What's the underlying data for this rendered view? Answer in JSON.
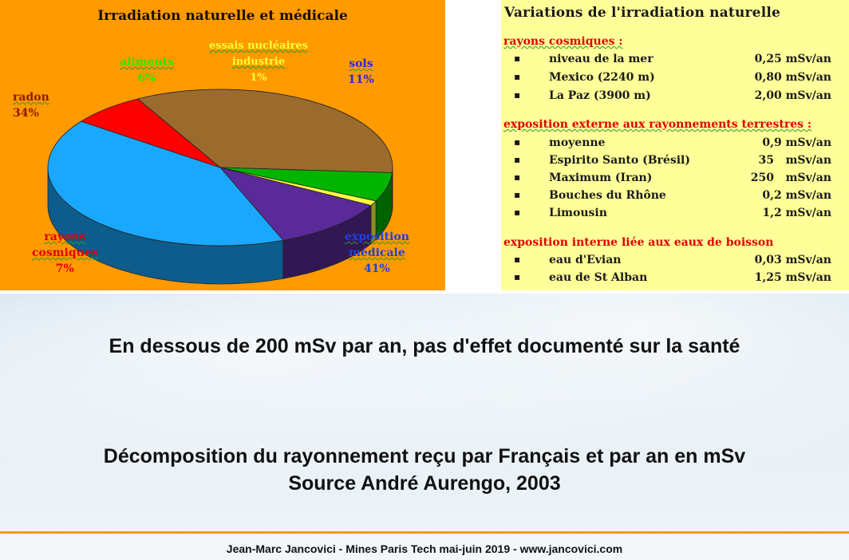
{
  "chart_data": {
    "type": "pie",
    "title": "Irradiation naturelle et médicale",
    "slices": [
      {
        "name": "radon",
        "percent_label": "34%",
        "value": 34,
        "color": "#9b6b2e",
        "label_color": "#8b1a00"
      },
      {
        "name": "aliments",
        "percent_label": "6%",
        "value": 6,
        "color": "#00b400",
        "label_color": "#2ee600"
      },
      {
        "name": "essais nucléaires industrie",
        "percent_label": "1%",
        "value": 1,
        "color": "#ffff40",
        "label_color": "#ffff33"
      },
      {
        "name": "sols",
        "percent_label": "11%",
        "value": 11,
        "color": "#5a2a9a",
        "label_color": "#2a2ad0"
      },
      {
        "name": "exposition médicale",
        "percent_label": "41%",
        "value": 41,
        "color": "#1aa8ff",
        "label_color": "#2040e0"
      },
      {
        "name": "rayons cosmiques",
        "percent_label": "7%",
        "value": 7,
        "color": "#ff0000",
        "label_color": "#e00000"
      }
    ],
    "labels": {
      "radon": "radon",
      "aliments": "aliments",
      "essais_line1": "essais nucléaires",
      "essais_line2": "industrie",
      "sols": "sols",
      "medicale_line1": "exposition",
      "medicale_line2": "médicale",
      "cosmiques_line1": "rayons",
      "cosmiques_line2": "cosmiques"
    }
  },
  "variations": {
    "title": "Variations  de l'irradiation  naturelle",
    "sections": [
      {
        "heading": "rayons cosmiques :",
        "rows": [
          {
            "bullet": "▪",
            "label": "niveau de la mer",
            "value": "0,25 mSv/an"
          },
          {
            "bullet": "▪",
            "label": "Mexico (2240 m)",
            "value": "0,80 mSv/an"
          },
          {
            "bullet": "▪",
            "label": "La Paz (3900 m)",
            "value": "2,00 mSv/an"
          }
        ]
      },
      {
        "heading": "exposition externe aux rayonnements terrestres :",
        "rows": [
          {
            "bullet": "▪",
            "label": "moyenne",
            "value": "0,9 mSv/an"
          },
          {
            "bullet": "▪",
            "label": "Espirito Santo (Brésil)",
            "value": "35   mSv/an"
          },
          {
            "bullet": "▪",
            "label": "Maximum (Iran)",
            "value": "250   mSv/an"
          },
          {
            "bullet": "▪",
            "label": "Bouches du Rhône",
            "value": "0,2 mSv/an"
          },
          {
            "bullet": "▪",
            "label": "Limousin",
            "value": "1,2 mSv/an"
          }
        ]
      },
      {
        "heading": "exposition interne liée aux eaux de boisson",
        "rows": [
          {
            "bullet": "▪",
            "label": "eau d'Evian",
            "value": "0,03 mSv/an"
          },
          {
            "bullet": "▪",
            "label": "eau de St Alban",
            "value": "1,25 mSv/an"
          }
        ]
      }
    ]
  },
  "statement": "En dessous de 200 mSv par an, pas d'effet documenté sur la santé",
  "caption": {
    "line1": "Décomposition du rayonnement reçu par Français et par an en mSv",
    "line2": "Source André Aurengo, 2003"
  },
  "footer": "Jean-Marc Jancovici - Mines Paris Tech mai-juin 2019 - www.jancovici.com",
  "colors": {
    "chart_background": "#ff9a00",
    "panel_background": "#ffff99",
    "heading_red": "#e00000",
    "footer_rule": "#f39a1e"
  }
}
